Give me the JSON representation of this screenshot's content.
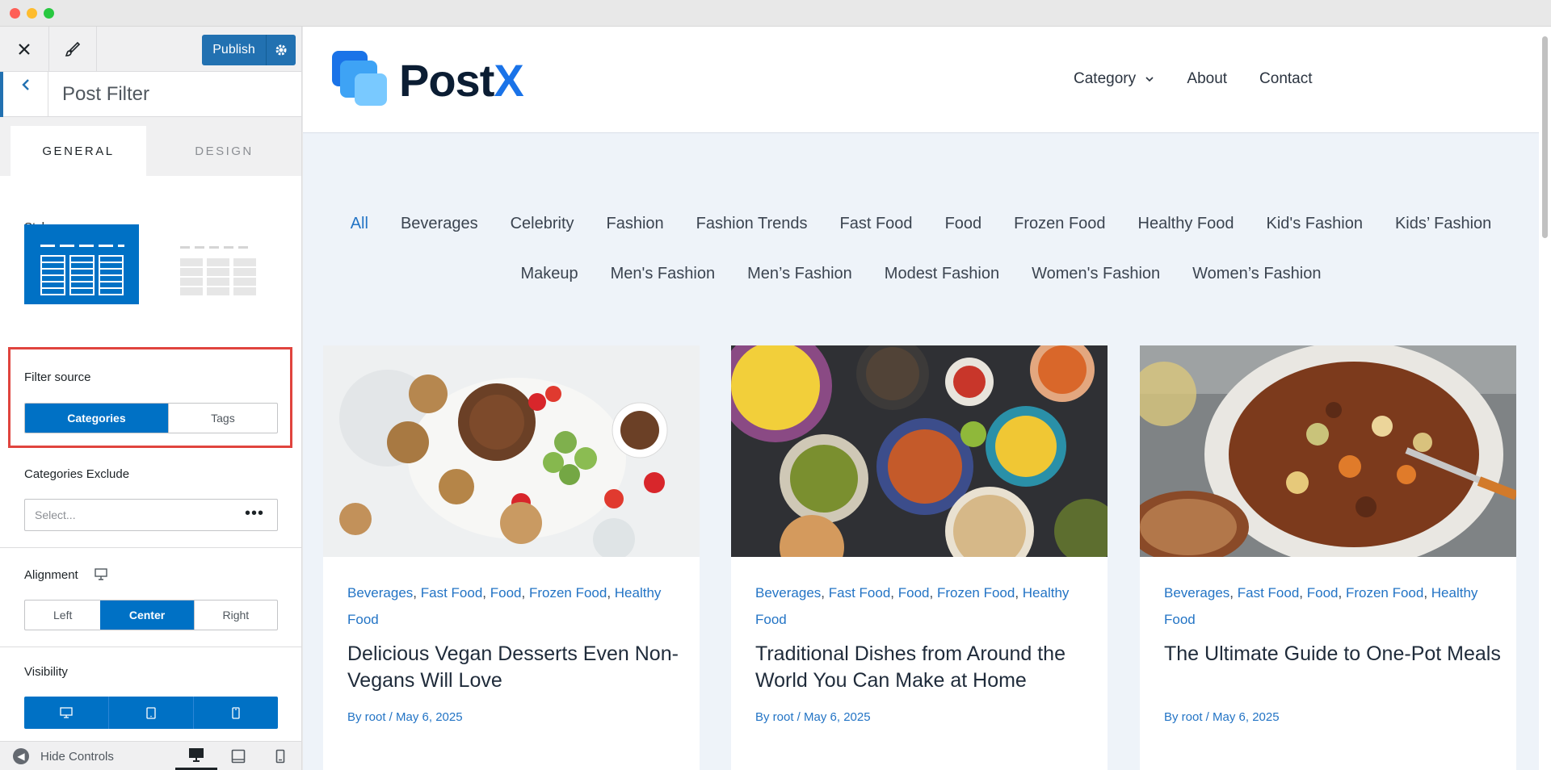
{
  "customizer": {
    "publish_label": "Publish",
    "section_title": "Post Filter",
    "tabs": [
      "GENERAL",
      "DESIGN"
    ],
    "style_label": "Style",
    "filter_source_label": "Filter source",
    "filter_source_options": [
      "Categories",
      "Tags"
    ],
    "filter_source_selected": "Categories",
    "categories_exclude_label": "Categories Exclude",
    "categories_exclude_placeholder": "Select...",
    "alignment_label": "Alignment",
    "alignment_options": [
      "Left",
      "Center",
      "Right"
    ],
    "alignment_selected": "Center",
    "visibility_label": "Visibility",
    "hide_controls_label": "Hide Controls",
    "accent_color": "#0071c5",
    "highlight_color": "#e0443e"
  },
  "site": {
    "logo_part1": "Post",
    "logo_part2": "X",
    "nav": [
      "Category",
      "About",
      "Contact"
    ],
    "filters_row1": [
      "All",
      "Beverages",
      "Celebrity",
      "Fashion",
      "Fashion Trends",
      "Fast Food",
      "Food",
      "Frozen Food",
      "Healthy Food",
      "Kid's Fashion",
      "Kids’ Fashion"
    ],
    "filters_row2": [
      "Makeup",
      "Men's Fashion",
      "Men’s Fashion",
      "Modest Fashion",
      "Women's Fashion",
      "Women’s Fashion"
    ],
    "active_filter": "All",
    "posts": [
      {
        "categories": [
          "Beverages",
          "Fast Food",
          "Food",
          "Frozen Food",
          "Healthy Food"
        ],
        "title": "Delicious Vegan Desserts Even Non-Vegans Will Love",
        "meta": "By root / May 6, 2025",
        "image": "food-photo"
      },
      {
        "categories": [
          "Beverages",
          "Fast Food",
          "Food",
          "Frozen Food",
          "Healthy Food"
        ],
        "title": "Traditional Dishes from Around the World You Can Make at Home",
        "meta": "By root / May 6, 2025",
        "image": "food-photo"
      },
      {
        "categories": [
          "Beverages",
          "Fast Food",
          "Food",
          "Frozen Food",
          "Healthy Food"
        ],
        "title": "The Ultimate Guide to One-Pot Meals",
        "meta": "By root / May 6, 2025",
        "image": "food-photo"
      }
    ]
  }
}
